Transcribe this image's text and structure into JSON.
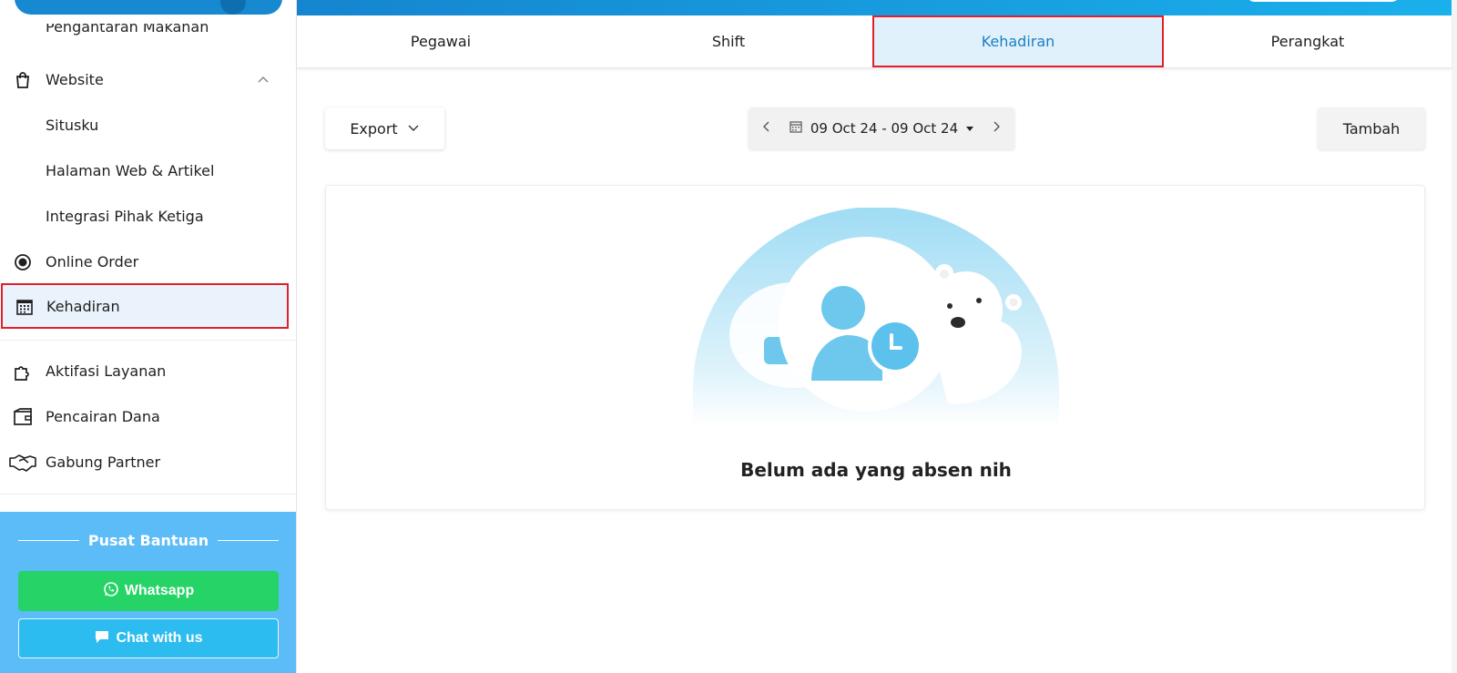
{
  "sidebar": {
    "cut_item": "Pengantaran Makanan",
    "website": {
      "label": "Website",
      "icon": "shopping-bag-icon",
      "expanded": true
    },
    "website_children": [
      "Situsku",
      "Halaman Web & Artikel",
      "Integrasi Pihak Ketiga"
    ],
    "online_order": {
      "label": "Online Order",
      "icon": "radio-dot-icon"
    },
    "kehadiran": {
      "label": "Kehadiran",
      "icon": "calendar-icon"
    },
    "aktifasi": {
      "label": "Aktifasi Layanan",
      "icon": "puzzle-icon"
    },
    "pencairan": {
      "label": "Pencairan Dana",
      "icon": "wallet-icon"
    },
    "partner": {
      "label": "Gabung Partner",
      "icon": "handshake-icon"
    }
  },
  "help": {
    "title": "Pusat Bantuan",
    "whatsapp_label": "Whatsapp",
    "chat_label": "Chat with us"
  },
  "tabs": [
    "Pegawai",
    "Shift",
    "Kehadiran",
    "Perangkat"
  ],
  "active_tab": "Kehadiran",
  "toolbar": {
    "export_label": "Export",
    "date_range": "09 Oct 24 - 09 Oct 24",
    "add_label": "Tambah"
  },
  "empty_state": {
    "message": "Belum ada yang absen nih"
  },
  "colors": {
    "accent": "#1a7fc4",
    "highlight_border": "#e0202a",
    "help_bg": "#5bbcf8",
    "whatsapp": "#25d366"
  }
}
